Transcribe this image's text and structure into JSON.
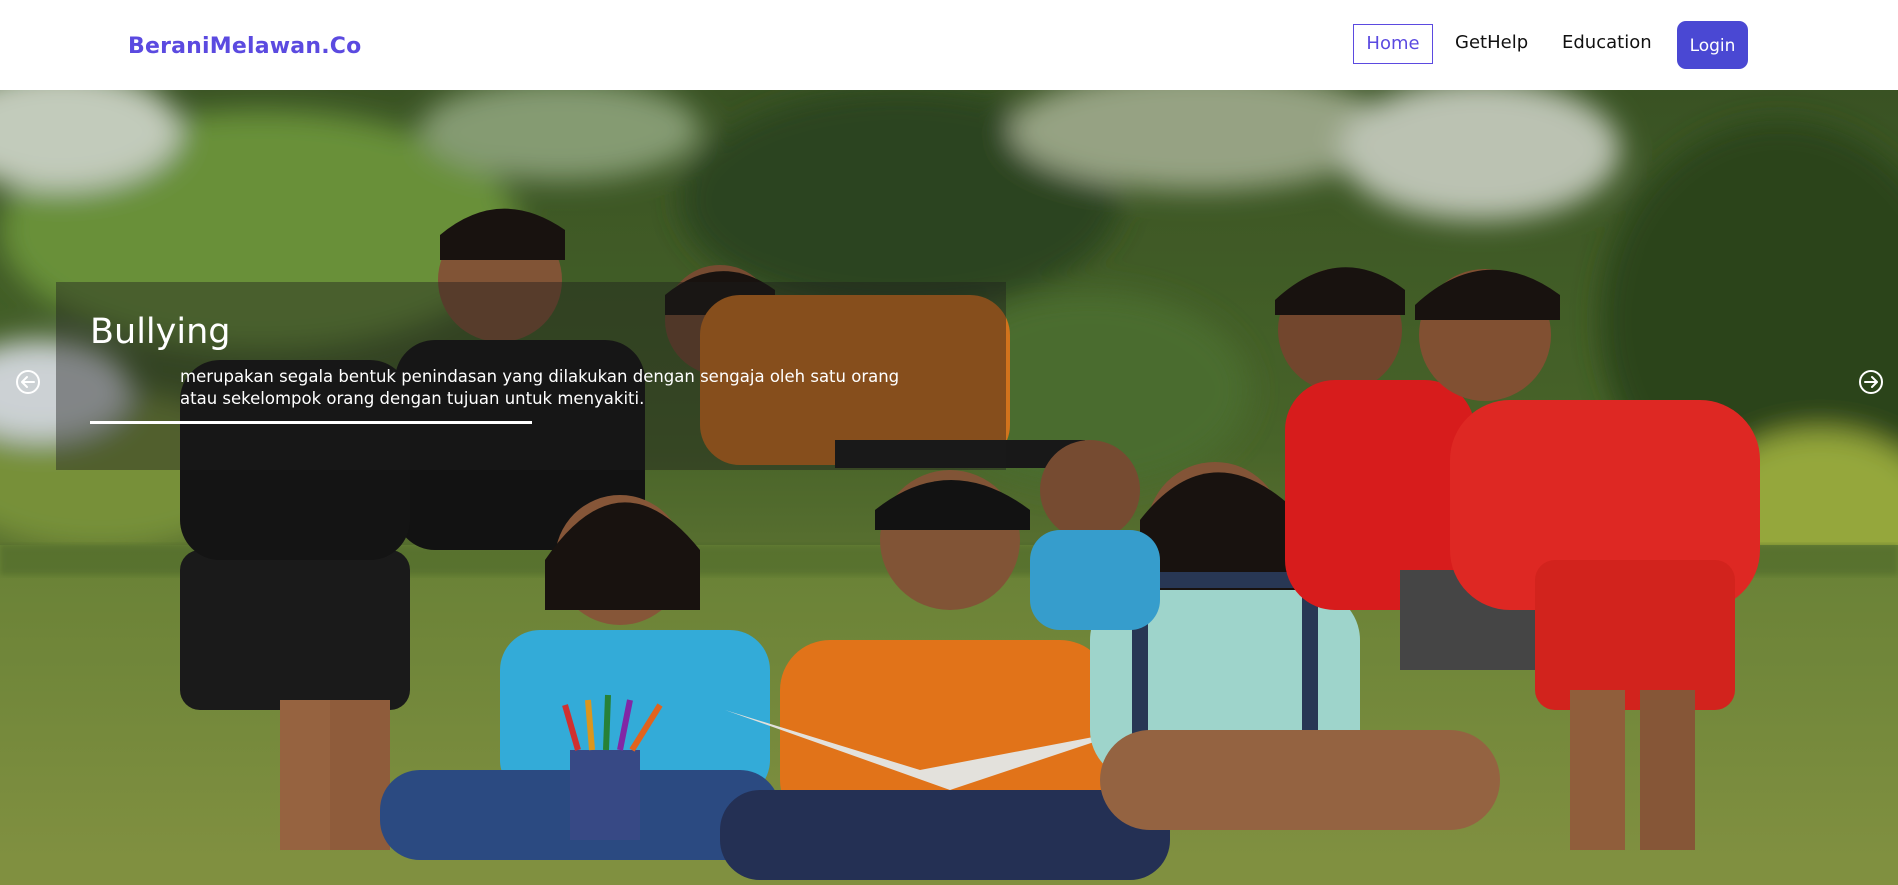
{
  "header": {
    "brand": "BeraniMelawan.Co",
    "nav": {
      "home": "Home",
      "gethelp": "GetHelp",
      "education": "Education"
    },
    "login_label": "Login"
  },
  "hero": {
    "image": "photo of a group of children sitting on grass, laughing while reading a book",
    "caption": {
      "title": "Bullying",
      "text": "merupakan segala bentuk penindasan yang dilakukan dengan sengaja oleh satu orang atau sekelompok orang dengan tujuan untuk menyakiti."
    },
    "controls": {
      "prev_icon": "arrow-left-circle-icon",
      "next_icon": "arrow-right-circle-icon"
    }
  },
  "colors": {
    "brand": "#5b4ae0",
    "login_button": "#4a48d3",
    "nav_text": "#111111",
    "caption_overlay": "rgba(28,28,28,0.42)"
  }
}
